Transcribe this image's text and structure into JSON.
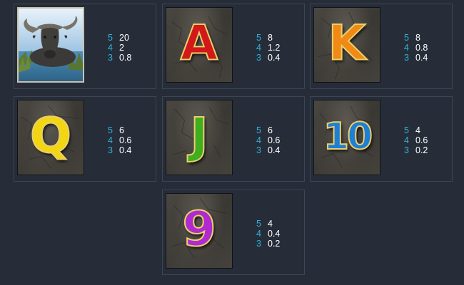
{
  "paytable": [
    {
      "symbol": "buffalo",
      "icon": "buffalo-icon",
      "kind": "photo",
      "pays": [
        {
          "count": "5",
          "value": "20"
        },
        {
          "count": "4",
          "value": "2"
        },
        {
          "count": "3",
          "value": "0.8"
        }
      ]
    },
    {
      "symbol": "A",
      "icon": "letter-a-icon",
      "kind": "glyph",
      "color": "#d21818",
      "pays": [
        {
          "count": "5",
          "value": "8"
        },
        {
          "count": "4",
          "value": "1.2"
        },
        {
          "count": "3",
          "value": "0.4"
        }
      ]
    },
    {
      "symbol": "K",
      "icon": "letter-k-icon",
      "kind": "glyph",
      "color": "#f08a14",
      "pays": [
        {
          "count": "5",
          "value": "8"
        },
        {
          "count": "4",
          "value": "0.8"
        },
        {
          "count": "3",
          "value": "0.4"
        }
      ]
    },
    {
      "symbol": "Q",
      "icon": "letter-q-icon",
      "kind": "glyph",
      "color": "#f2d612",
      "pays": [
        {
          "count": "5",
          "value": "6"
        },
        {
          "count": "4",
          "value": "0.6"
        },
        {
          "count": "3",
          "value": "0.4"
        }
      ]
    },
    {
      "symbol": "J",
      "icon": "letter-j-icon",
      "kind": "glyph",
      "color": "#3fae1f",
      "pays": [
        {
          "count": "5",
          "value": "6"
        },
        {
          "count": "4",
          "value": "0.6"
        },
        {
          "count": "3",
          "value": "0.4"
        }
      ]
    },
    {
      "symbol": "10",
      "icon": "number-10-icon",
      "kind": "glyph",
      "color": "#1d7fd6",
      "pays": [
        {
          "count": "5",
          "value": "4"
        },
        {
          "count": "4",
          "value": "0.6"
        },
        {
          "count": "3",
          "value": "0.2"
        }
      ]
    },
    {
      "symbol": "9",
      "icon": "number-9-icon",
      "kind": "glyph",
      "color": "#b02ad0",
      "pays": [
        {
          "count": "5",
          "value": "4"
        },
        {
          "count": "4",
          "value": "0.4"
        },
        {
          "count": "3",
          "value": "0.2"
        }
      ]
    }
  ]
}
